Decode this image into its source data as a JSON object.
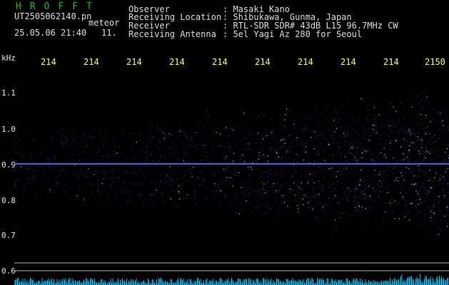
{
  "app": {
    "logo": "HROFFT"
  },
  "file": {
    "name": "UT2505062140.pn",
    "datetime": "25.05.06 21:40",
    "mode": "meteor",
    "count": "11."
  },
  "info": {
    "observer_label": "Observer",
    "observer_value": ": Masaki Kano",
    "location_label": "Receiving Location",
    "location_value": ": Shibukawa, Gunma, Japan",
    "receiver_label": "Receiver",
    "receiver_value": ": RTL-SDR SDR# 43dB L15 96.7MHz CW",
    "antenna_label": "Receiving Antenna",
    "antenna_value": ": 5el Yagi Az 280 for Seoul"
  },
  "axis": {
    "unit": "kHz",
    "y_ticks": [
      "1.1",
      "1.0",
      "0.9",
      "0.8",
      "0.7",
      "0.6"
    ],
    "x_ticks": [
      "214",
      "214",
      "214",
      "214",
      "214",
      "214",
      "214",
      "214",
      "214",
      "2150"
    ]
  },
  "colors": {
    "background": "#000000",
    "logo": "#00c800",
    "time_ticks": "#ffff50",
    "signal": "#2840ff",
    "baseline": "#00c8ff"
  }
}
